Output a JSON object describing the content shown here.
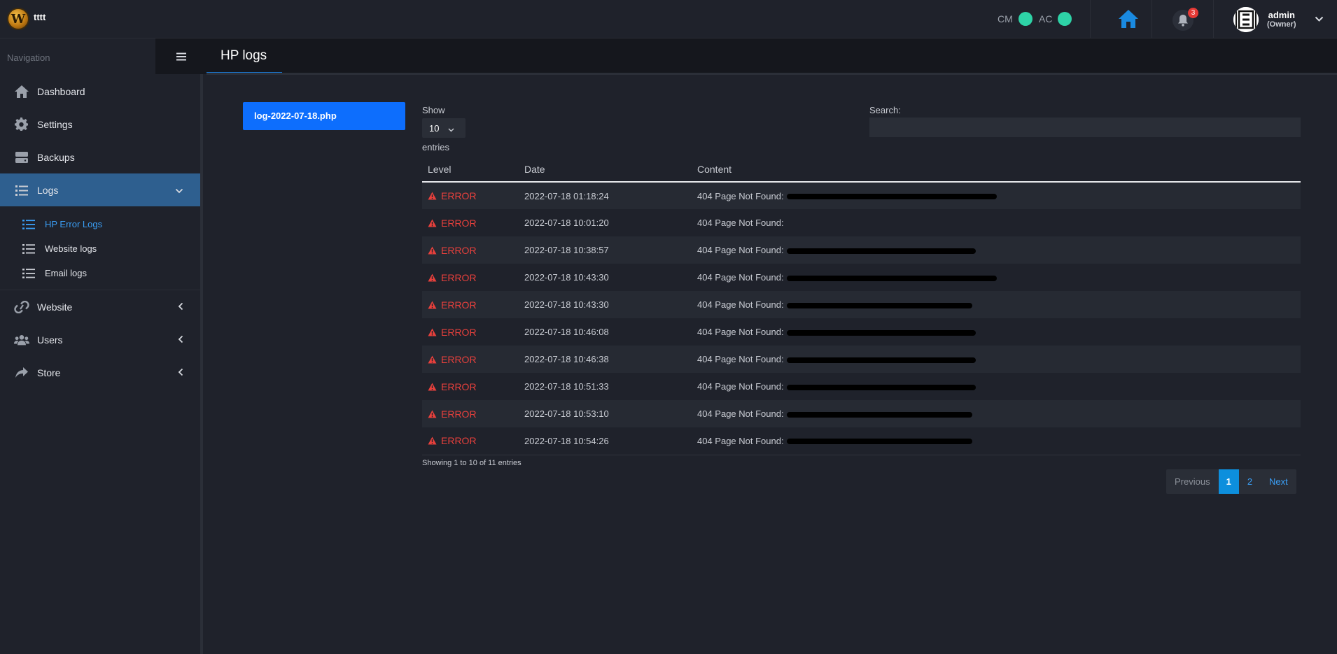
{
  "brand": {
    "logo_letter": "W",
    "name": "tttt"
  },
  "status": [
    {
      "label": "CM",
      "color": "#2ed3a7"
    },
    {
      "label": "AC",
      "color": "#2ed3a7"
    }
  ],
  "notifications": {
    "count": "3"
  },
  "user": {
    "name": "admin",
    "role": "(Owner)"
  },
  "sidebar": {
    "header": "Navigation",
    "items": [
      {
        "label": "Dashboard",
        "icon": "home-icon"
      },
      {
        "label": "Settings",
        "icon": "gear-icon"
      },
      {
        "label": "Backups",
        "icon": "hdd-icon"
      },
      {
        "label": "Logs",
        "icon": "list-icon"
      },
      {
        "label": "Website",
        "icon": "link-icon"
      },
      {
        "label": "Users",
        "icon": "users-icon"
      },
      {
        "label": "Store",
        "icon": "share-icon"
      }
    ],
    "logs_sub": [
      {
        "label": "HP Error Logs"
      },
      {
        "label": "Website logs"
      },
      {
        "label": "Email logs"
      }
    ]
  },
  "page": {
    "title": "HP logs"
  },
  "file_button": "log-2022-07-18.php",
  "length": {
    "label": "Show",
    "value": "10",
    "suffix": "entries"
  },
  "search": {
    "label": "Search:",
    "value": ""
  },
  "table": {
    "headers": [
      "Level",
      "Date",
      "Content"
    ],
    "rows": [
      {
        "level": "ERROR",
        "date": "2022-07-18 01:18:24",
        "content": "404 Page Not Found:"
      },
      {
        "level": "ERROR",
        "date": "2022-07-18 10:01:20",
        "content": "404 Page Not Found:"
      },
      {
        "level": "ERROR",
        "date": "2022-07-18 10:38:57",
        "content": "404 Page Not Found:"
      },
      {
        "level": "ERROR",
        "date": "2022-07-18 10:43:30",
        "content": "404 Page Not Found:"
      },
      {
        "level": "ERROR",
        "date": "2022-07-18 10:43:30",
        "content": "404 Page Not Found:"
      },
      {
        "level": "ERROR",
        "date": "2022-07-18 10:46:08",
        "content": "404 Page Not Found:"
      },
      {
        "level": "ERROR",
        "date": "2022-07-18 10:46:38",
        "content": "404 Page Not Found:"
      },
      {
        "level": "ERROR",
        "date": "2022-07-18 10:51:33",
        "content": "404 Page Not Found:"
      },
      {
        "level": "ERROR",
        "date": "2022-07-18 10:53:10",
        "content": "404 Page Not Found:"
      },
      {
        "level": "ERROR",
        "date": "2022-07-18 10:54:26",
        "content": "404 Page Not Found:"
      }
    ]
  },
  "info": "Showing 1 to 10 of 11 entries",
  "pagination": {
    "previous": "Previous",
    "pages": [
      "1",
      "2"
    ],
    "next": "Next"
  },
  "colors": {
    "accent": "#0d6efd",
    "active_nav": "#2e5f8f",
    "error": "#e8403c",
    "link": "#3a9ef5"
  }
}
